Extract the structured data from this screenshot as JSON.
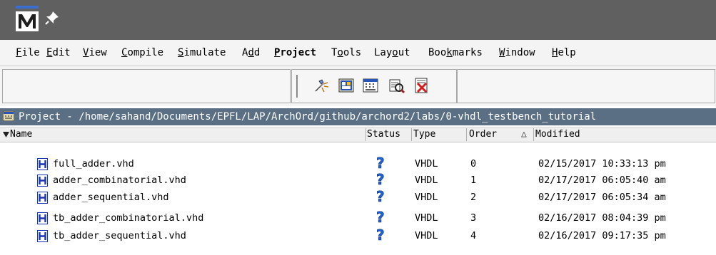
{
  "menu": {
    "file": {
      "mn": "F",
      "rest": "ile"
    },
    "edit": {
      "mn": "E",
      "rest": "dit"
    },
    "view": {
      "mn": "V",
      "rest": "iew"
    },
    "compile": {
      "mn": "C",
      "rest": "ompile"
    },
    "simulate": {
      "mn": "S",
      "rest": "imulate"
    },
    "add": {
      "pre": "A",
      "mn": "d",
      "rest": "d"
    },
    "project": {
      "mn": "P",
      "rest": "roject"
    },
    "tools": {
      "pre": "T",
      "mn": "o",
      "rest": "ols"
    },
    "layout": {
      "pre": "Lay",
      "mn": "o",
      "rest": "ut"
    },
    "bookmarks": {
      "pre": "Boo",
      "mn": "k",
      "rest": "marks"
    },
    "window": {
      "mn": "W",
      "rest": "indow"
    },
    "help": {
      "mn": "H",
      "rest": "elp"
    }
  },
  "toolbar": {
    "icons": [
      "compile-icon",
      "compile-all-icon",
      "simulate-icon",
      "project-settings-icon",
      "close-project-icon"
    ]
  },
  "project": {
    "header": "Project - /home/sahand/Documents/EPFL/LAP/ArchOrd/github/archord2/labs/0-vhdl_testbench_tutorial"
  },
  "columns": {
    "name": "Name",
    "status": "Status",
    "type": "Type",
    "order": "Order",
    "sort_indicator": "△",
    "modified": "Modified"
  },
  "files": [
    {
      "name": "full_adder.vhd",
      "status": "?",
      "type": "VHDL",
      "order": "0",
      "modified": "02/15/2017 10:33:13 pm"
    },
    {
      "name": "adder_combinatorial.vhd",
      "status": "?",
      "type": "VHDL",
      "order": "1",
      "modified": "02/17/2017 06:05:40 am"
    },
    {
      "name": "adder_sequential.vhd",
      "status": "?",
      "type": "VHDL",
      "order": "2",
      "modified": "02/17/2017 06:05:34 am"
    },
    {
      "name": "tb_adder_combinatorial.vhd",
      "status": "?",
      "type": "VHDL",
      "order": "3",
      "modified": "02/16/2017 08:04:39 pm"
    },
    {
      "name": "tb_adder_sequential.vhd",
      "status": "?",
      "type": "VHDL",
      "order": "4",
      "modified": "02/16/2017 09:17:35 pm"
    }
  ],
  "colors": {
    "titlebar": "#606060",
    "project_header": "#5a6f84",
    "file_icon": "#1a32b4",
    "status_icon": "#1c64d8"
  }
}
